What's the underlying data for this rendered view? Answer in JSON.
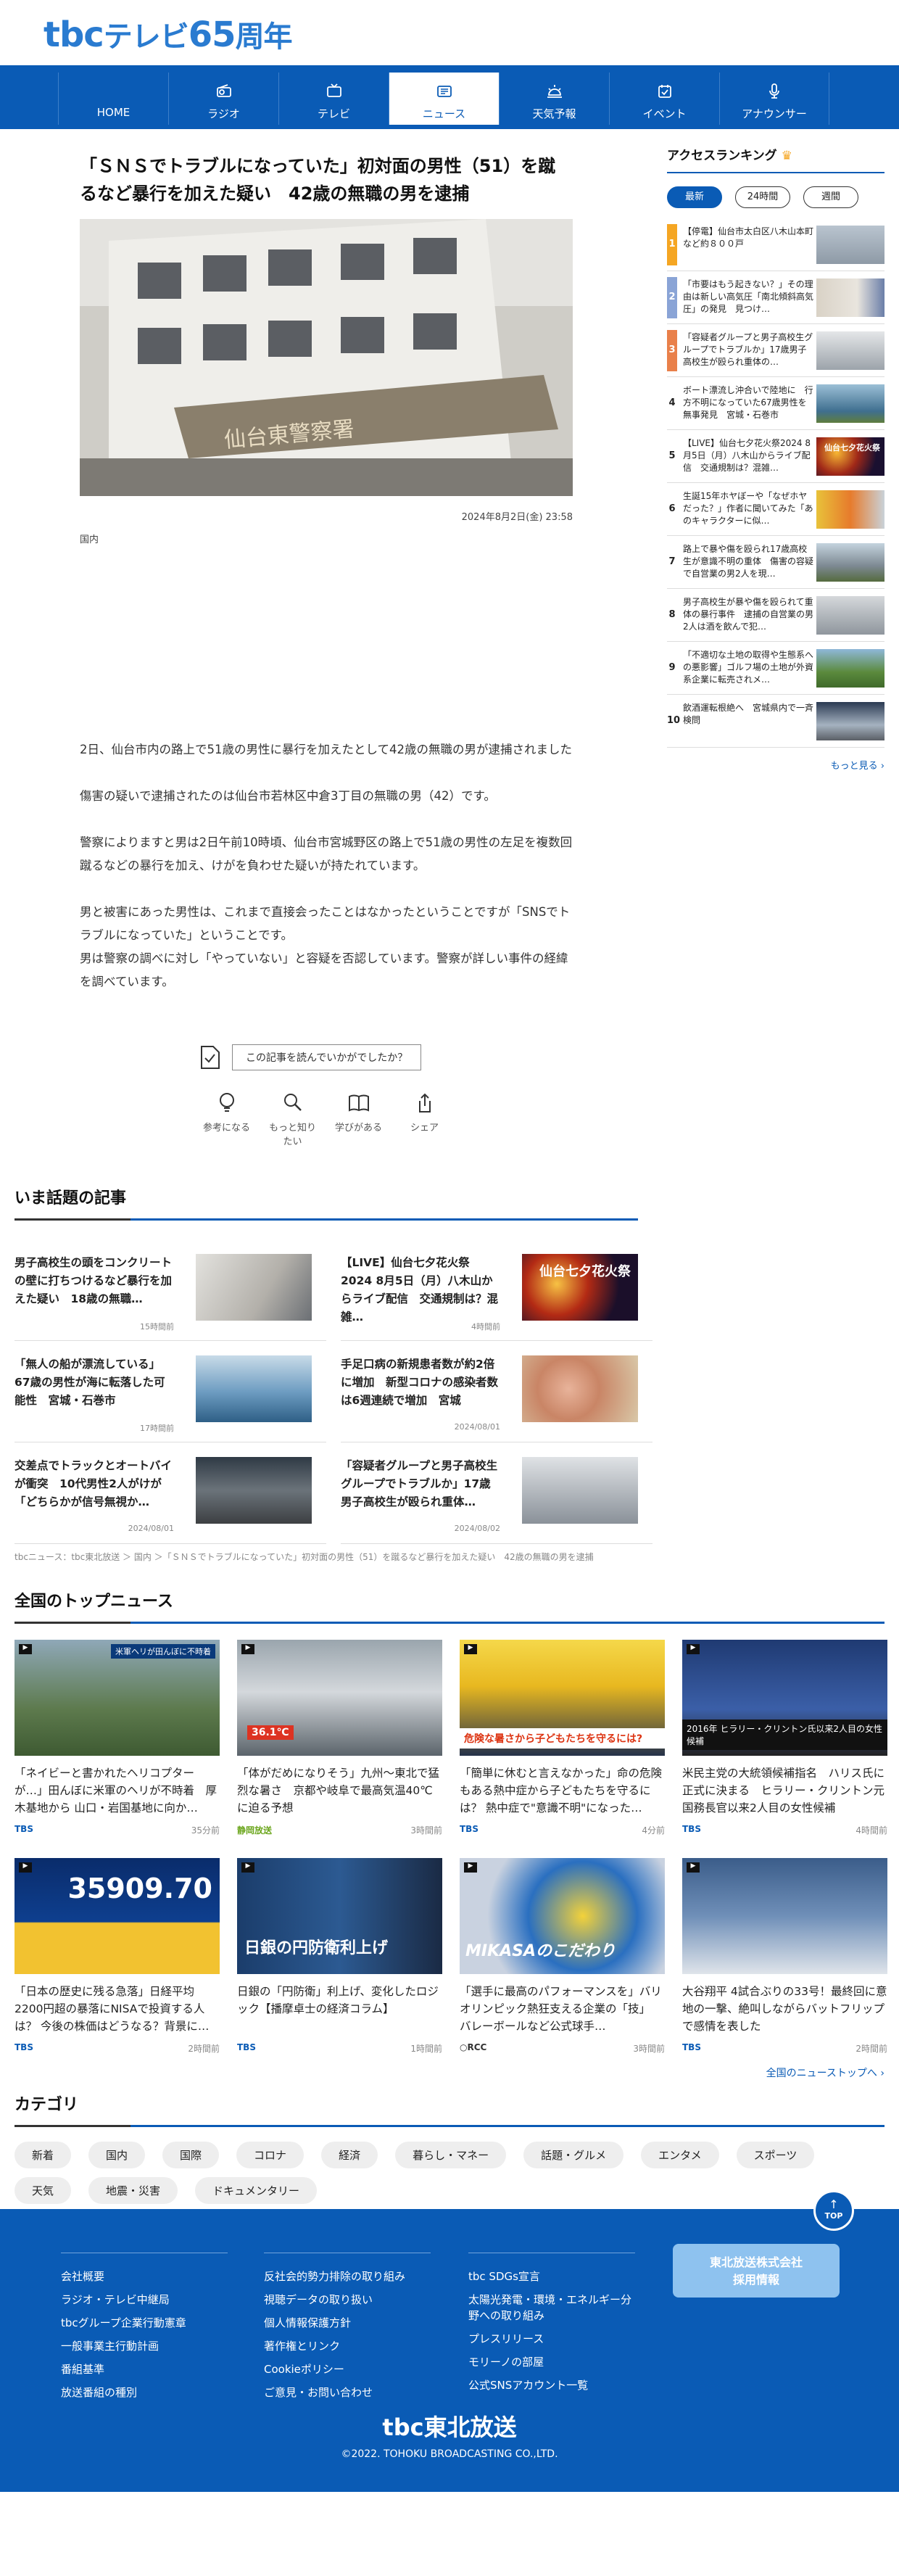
{
  "logo": {
    "brand": "tbc",
    "tagline": "テレビ",
    "num": "65",
    "suffix": "周年"
  },
  "nav": [
    {
      "label": "HOME",
      "icon": "home-icon"
    },
    {
      "label": "ラジオ",
      "icon": "radio-icon"
    },
    {
      "label": "テレビ",
      "icon": "tv-icon"
    },
    {
      "label": "ニュース",
      "icon": "news-icon"
    },
    {
      "label": "天気予報",
      "icon": "weather-icon"
    },
    {
      "label": "イベント",
      "icon": "event-icon"
    },
    {
      "label": "アナウンサー",
      "icon": "microphone-icon"
    }
  ],
  "article": {
    "title": "「ＳＮＳでトラブルになっていた」初対面の男性（51）を蹴るなど暴行を加えた疑い　42歳の無職の男を逮捕",
    "date": "2024年8月2日(金) 23:58",
    "category": "国内",
    "hero_sign": "仙台東警察署",
    "paragraphs": [
      "2日、仙台市内の路上で51歳の男性に暴行を加えたとして42歳の無職の男が逮捕されました",
      "傷害の疑いで逮捕されたのは仙台市若林区中倉3丁目の無職の男（42）です。",
      "警察によりますと男は2日午前10時頃、仙台市宮城野区の路上で51歳の男性の左足を複数回蹴るなどの暴行を加え、けがを負わせた疑いが持たれています。",
      "男と被害にあった男性は、これまで直接会ったことはなかったということですが「SNSでトラブルになっていた」ということです。\n男は警察の調べに対し「やっていない」と容疑を否認しています。警察が詳しい事件の経緯を調べています。"
    ]
  },
  "feedback": {
    "question": "この記事を読んでいかがでしたか？",
    "reactions": [
      {
        "label": "参考になる",
        "icon": "lightbulb-icon"
      },
      {
        "label": "もっと知りたい",
        "icon": "magnifier-icon"
      },
      {
        "label": "学びがある",
        "icon": "book-icon"
      },
      {
        "label": "シェア",
        "icon": "share-icon"
      }
    ]
  },
  "trending": {
    "title": "いま話題の記事",
    "items": [
      {
        "title": "男子高校生の頭をコンクリートの壁に打ちつけるなど暴行を加えた疑い　18歳の無職…",
        "age": "15時間前"
      },
      {
        "title": "【LIVE】仙台七夕花火祭2024 8月5日（月）八木山からライブ配信　交通規制は？混雑…",
        "age": "4時間前",
        "thumb_text": "仙台七夕花火祭"
      },
      {
        "title": "「無人の船が漂流している」67歳の男性が海に転落した可能性　宮城・石巻市",
        "age": "17時間前"
      },
      {
        "title": "手足口病の新規患者数が約2倍に増加　新型コロナの感染者数は6週連続で増加　宮城",
        "age": "2024/08/01"
      },
      {
        "title": "交差点でトラックとオートバイが衝突　10代男性2人がけが「どちらかが信号無視か…",
        "age": "2024/08/01"
      },
      {
        "title": "「容疑者グループと男子高校生グループでトラブルか」17歳男子高校生が殴られ重体…",
        "age": "2024/08/02"
      }
    ]
  },
  "breadcrumb": "tbcニュース：tbc東北放送 ＞ 国内 ＞「ＳＮＳでトラブルになっていた」初対面の男性（51）を蹴るなど暴行を加えた疑い　42歳の無職の男を逮捕",
  "topnews": {
    "title": "全国のトップニュース",
    "more": "全国のニューストップへ",
    "items": [
      {
        "title": "「ネイビーと書かれたヘリコプターが…」田んぼに米軍のヘリが不時着　厚木基地から 山口・岩国基地に向か…",
        "source": "TBS",
        "age": "35分前",
        "thumb_text": "米軍ヘリが田んぼに不時着"
      },
      {
        "title": "「体がだめになりそう」九州〜東北で猛烈な暑さ　京都や岐阜で最高気温40℃に迫る予想",
        "source": "静岡放送",
        "age": "3時間前",
        "thumb_text": "36.1℃"
      },
      {
        "title": "「簡単に休むと言えなかった」命の危険もある熱中症から子どもたちを守るには？ 熱中症で\"意識不明\"になった…",
        "source": "TBS",
        "age": "4分前",
        "thumb_text": "危険な暑さから子どもたちを守るには?"
      },
      {
        "title": "米民主党の大統領候補指名　ハリス氏に正式に決まる　ヒラリー・クリントン元国務長官以来2人目の女性候補",
        "source": "TBS",
        "age": "4時間前",
        "thumb_text": "2016年 ヒラリー・クリントン氏以来2人目の女性候補"
      },
      {
        "title": "「日本の歴史に残る急落」日経平均2200円超の暴落にNISAで投資する人は？ 今後の株価はどうなる？背景に…",
        "source": "TBS",
        "age": "2時間前",
        "thumb_text": "35909.70"
      },
      {
        "title": "日銀の「円防衛」利上げ、変化したロジック【播摩卓士の経済コラム】",
        "source": "TBS",
        "age": "1時間前",
        "thumb_text": "日銀の円防衛利上げ"
      },
      {
        "title": "「選手に最高のパフォーマンスを」バリオリンピック熱狂支える企業の「技」　バレーボールなど公式球手…",
        "source": "RCC",
        "age": "3時間前",
        "thumb_text": "MIKASAのこだわり"
      },
      {
        "title": "大谷翔平 4試合ぶりの33号！最終回に意地の一撃、絶叫しながらバットフリップで感情を表した",
        "source": "TBS",
        "age": "2時間前"
      }
    ]
  },
  "category": {
    "title": "カテゴリ",
    "chips": [
      "新着",
      "国内",
      "国際",
      "コロナ",
      "経済",
      "暮らし・マネー",
      "話題・グルメ",
      "エンタメ",
      "スポーツ",
      "天気",
      "地震・災害",
      "ドキュメンタリー"
    ]
  },
  "top_button": "TOP",
  "footer": {
    "col1": [
      "会社概要",
      "ラジオ・テレビ中継局",
      "tbcグループ企業行動憲章",
      "一般事業主行動計画",
      "番組基準",
      "放送番組の種別"
    ],
    "col2": [
      "反社会的勢力排除の取り組み",
      "視聴データの取り扱い",
      "個人情報保護方針",
      "著作権とリンク",
      "Cookieポリシー",
      "ご意見・お問い合わせ"
    ],
    "col3": [
      "tbc SDGs宣言",
      "太陽光発電・環境・エネルギー分野への取り組み",
      "プレスリリース",
      "モリーノの部屋",
      "公式SNSアカウント一覧"
    ],
    "recruit_line1": "東北放送株式会社",
    "recruit_line2": "採用情報",
    "logo": "tbc東北放送",
    "copyright": "©2022. TOHOKU BROADCASTING CO.,LTD."
  },
  "ranking": {
    "title": "アクセスランキング",
    "tabs": [
      "最新",
      "24時間",
      "週間"
    ],
    "more": "もっと見る",
    "items": [
      {
        "rank": "1",
        "title": "【停電】仙台市太白区八木山本町など約８００戸"
      },
      {
        "rank": "2",
        "title": "「市要はもう起きない？」その理由は新しい高気圧「南北傾斜高気圧」の発見　見つけ…"
      },
      {
        "rank": "3",
        "title": "「容疑者グループと男子高校生グループでトラブルか」17歳男子高校生が殴られ重体の…"
      },
      {
        "rank": "4",
        "title": "ボート漂流し沖合いで陸地に　行方不明になっていた67歳男性を無事発見　宮城・石巻市"
      },
      {
        "rank": "5",
        "title": "【LIVE】仙台七夕花火祭2024 8月5日（月）八木山からライブ配信　交通規制は？混雑…",
        "thumb_text": "仙台七夕花火祭"
      },
      {
        "rank": "6",
        "title": "生誕15年ホヤぼーや「なぜホヤだった？」作者に聞いてみた「あのキャラクターに似…"
      },
      {
        "rank": "7",
        "title": "路上で暴や傷を殴られ17歳高校生が意識不明の重体　傷害の容疑で自営業の男2人を現…"
      },
      {
        "rank": "8",
        "title": "男子高校生が暴や傷を殴られて重体の暴行事件　逮捕の自営業の男2人は酒を飲んで犯…"
      },
      {
        "rank": "9",
        "title": "「不適切な土地の取得や生態系への悪影響」ゴルフ場の土地が外資系企業に転売されメ…"
      },
      {
        "rank": "10",
        "title": "飲酒運転根絶へ　宮城県内で一斉検問"
      }
    ]
  }
}
